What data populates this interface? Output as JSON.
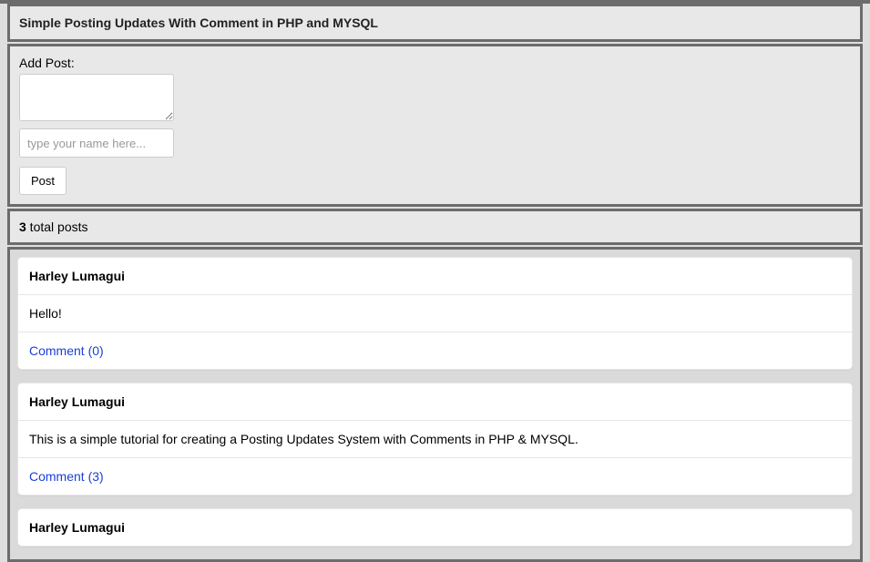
{
  "header": {
    "title": "Simple Posting Updates With Comment in PHP and MYSQL"
  },
  "addPost": {
    "label": "Add Post:",
    "namePlaceholder": "type your name here...",
    "buttonLabel": "Post"
  },
  "countBar": {
    "count": "3",
    "label": " total posts"
  },
  "posts": [
    {
      "author": "Harley Lumagui",
      "content": "Hello!",
      "commentLabel": "Comment (0)"
    },
    {
      "author": "Harley Lumagui",
      "content": "This is a simple tutorial for creating a Posting Updates System with Comments in PHP & MYSQL.",
      "commentLabel": "Comment (3)"
    },
    {
      "author": "Harley Lumagui",
      "content": "",
      "commentLabel": ""
    }
  ]
}
